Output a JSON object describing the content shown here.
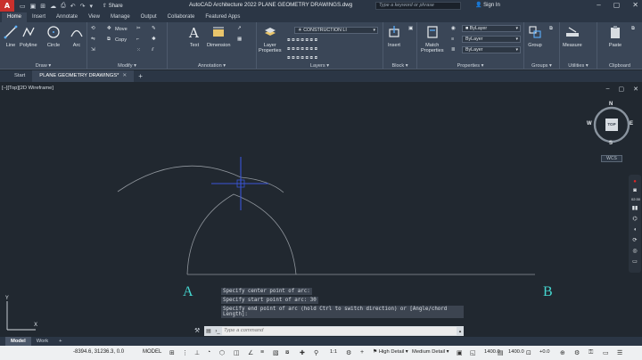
{
  "title_bar": {
    "logo": "A",
    "share_label": "Share",
    "app_title": "AutoCAD Architecture 2022   PLANE GEOMETRY DRAWINGS.dwg",
    "search_placeholder": "Type a keyword or phrase",
    "signin_label": "Sign In"
  },
  "ribbon_tabs": [
    "Home",
    "Insert",
    "Annotate",
    "View",
    "Manage",
    "Output",
    "Collaborate",
    "Featured Apps"
  ],
  "ribbon": {
    "draw": {
      "label": "Draw",
      "line": "Line",
      "polyline": "Polyline",
      "circle": "Circle",
      "arc": "Arc"
    },
    "modify": {
      "label": "Modify",
      "move": "Move",
      "copy": "Copy"
    },
    "annotation": {
      "label": "Annotation",
      "text": "Text",
      "dimension": "Dimension"
    },
    "layers": {
      "label": "Layers",
      "layer_properties_1": "Layer",
      "layer_properties_2": "Properties",
      "current_layer": "CONSTRUCTION LI"
    },
    "block": {
      "label": "Block",
      "insert": "Insert"
    },
    "properties": {
      "label": "Properties",
      "match_1": "Match",
      "match_2": "Properties",
      "bylayer_1": "ByLayer",
      "bylayer_2": "ByLayer",
      "bylayer_3": "ByLayer"
    },
    "groups": {
      "label": "Groups",
      "group": "Group"
    },
    "utilities": {
      "label": "Utilities",
      "measure": "Measure"
    },
    "clipboard": {
      "label": "Clipboard",
      "paste": "Paste"
    }
  },
  "doc_tabs": {
    "start": "Start",
    "drawing": "PLANE GEOMETRY DRAWINGS*"
  },
  "viewport": {
    "label": "[–][Top][2D Wireframe]"
  },
  "viewcube": {
    "n": "N",
    "s": "S",
    "e": "E",
    "w": "W",
    "top": "TOP",
    "wcs": "WCS"
  },
  "recorder": {
    "time": "02:30"
  },
  "points": {
    "a": "A",
    "b": "B"
  },
  "command_history": [
    "Specify center point of arc:",
    "Specify start point of arc: 30",
    "Specify end point of arc (hold Ctrl to switch direction) or [Angle/chord Length]:"
  ],
  "command_input": {
    "placeholder": "Type a command"
  },
  "layout_tabs": {
    "model": "Model",
    "work": "Work"
  },
  "status_bar": {
    "coords": "-8394.6, 31236.3, 0.0",
    "model": "MODEL",
    "scale": "1:1",
    "high_detail": "High Detail",
    "medium_detail": "Medium Detail",
    "value_1": "1400.0",
    "value_2": "1400.0",
    "value_3": "+0.0"
  },
  "colors": {
    "canvas": "#212830",
    "ribbon": "#3a4657",
    "title": "#2b3645",
    "crosshair": "#3a55d8",
    "point_label": "#45d6cf",
    "record": "#e02424"
  }
}
